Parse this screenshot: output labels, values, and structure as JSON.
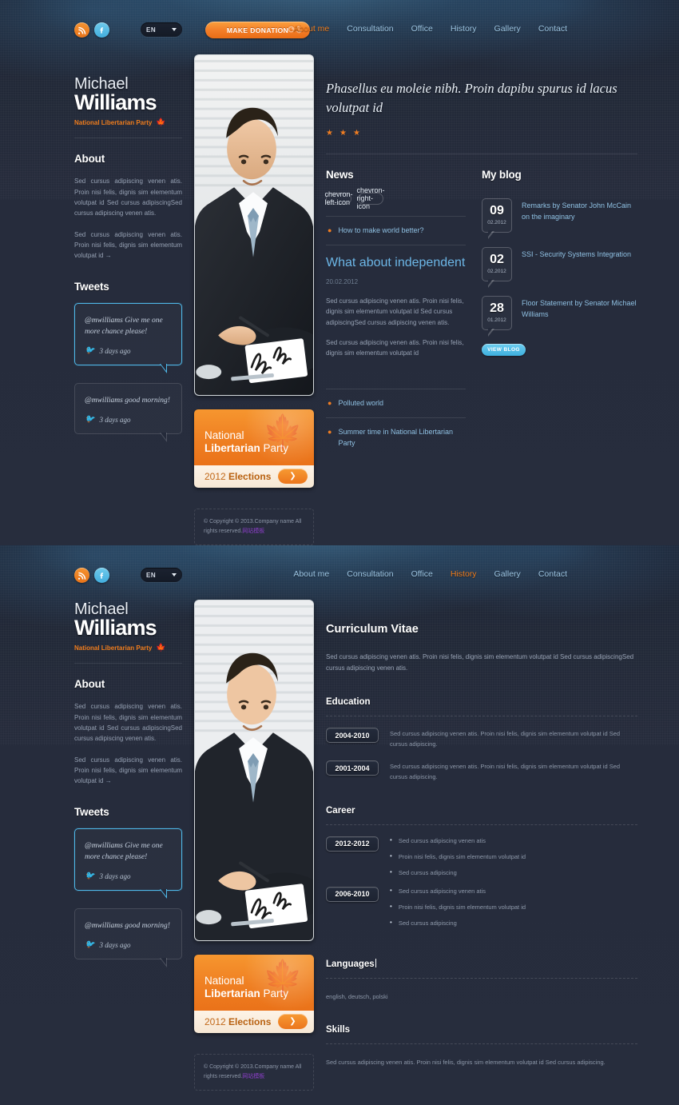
{
  "brand": {
    "first_name": "Michael",
    "last_name": "Williams",
    "party": "National Libertarian Party",
    "leaf_icon": "maple-leaf-icon"
  },
  "header": {
    "social": [
      {
        "name": "rss-icon",
        "label": "RSS"
      },
      {
        "name": "facebook-icon",
        "label": "f"
      }
    ],
    "language": {
      "value": "EN",
      "caret": "chevron-down-icon"
    },
    "donation_button": "MAKE DONATION",
    "nav": [
      {
        "label": "About me",
        "active": true
      },
      {
        "label": "Consultation",
        "active": false
      },
      {
        "label": "Office",
        "active": false
      },
      {
        "label": "History",
        "active": false
      },
      {
        "label": "Gallery",
        "active": false
      },
      {
        "label": "Contact",
        "active": false
      }
    ]
  },
  "header2": {
    "nav": [
      {
        "label": "About me",
        "active": false
      },
      {
        "label": "Consultation",
        "active": false
      },
      {
        "label": "Office",
        "active": false
      },
      {
        "label": "History",
        "active": true
      },
      {
        "label": "Gallery",
        "active": false
      },
      {
        "label": "Contact",
        "active": false
      }
    ]
  },
  "sidebar": {
    "about_title": "About",
    "about_p1": "Sed cursus adipiscing venen atis. Proin nisi felis, dignis sim elementum volutpat id Sed cursus adipiscingSed cursus adipiscing venen atis.",
    "about_p2": "Sed cursus adipiscing venen atis. Proin nisi felis, dignis sim elementum volutpat id",
    "about_arrow": "→",
    "tweets_title": "Tweets",
    "tweets": [
      {
        "handle": "@mwilliams",
        "text": "Give me one more chance please!",
        "time": "3 days ago",
        "active": true
      },
      {
        "handle": "@mwilliams",
        "text": "good morning!",
        "time": "3 days ago",
        "active": false
      }
    ]
  },
  "banner": {
    "line1": "National",
    "line2_bold": "Libertarian",
    "line2_rest": " Party",
    "bottom_year": "2012 ",
    "bottom_bold": "Elections",
    "go_icon": "chevron-right-icon"
  },
  "footer": {
    "text": "© Copyright © 2013.Company name All rights reserved.",
    "cn_text": "网站模板"
  },
  "main": {
    "quote": "Phasellus eu moleie nibh. Proin dapibu spurus id lacus volutpat id",
    "stars": [
      "★",
      "★",
      "★"
    ],
    "news": {
      "title": "News",
      "prev_icon": "chevron-left-icon",
      "next_icon": "chevron-right-icon",
      "top_item": "How to make world better?",
      "headline": "What about independent",
      "date": "20.02.2012",
      "body_p1": "Sed cursus adipiscing venen atis. Proin nisi felis, dignis sim elementum volutpat id Sed cursus adipiscingSed cursus adipiscing venen atis.",
      "body_p2": "Sed cursus adipiscing venen atis. Proin nisi felis, dignis sim elementum volutpat id",
      "more_items": [
        "Polluted world",
        "Summer time in National Libertarian Party"
      ]
    },
    "blog": {
      "title": "My blog",
      "entries": [
        {
          "day": "09",
          "monthyear": "02.2012",
          "title": "Remarks by Senator John McCain on the imaginary"
        },
        {
          "day": "02",
          "monthyear": "02.2012",
          "title": "SSI - Security Systems Integration"
        },
        {
          "day": "28",
          "monthyear": "01.2012",
          "title": "Floor Statement by Senator Michael Williams"
        }
      ],
      "view_button": "VIEW BLOG"
    }
  },
  "cv": {
    "title": "Curriculum Vitae",
    "intro": "Sed cursus adipiscing venen atis. Proin nisi felis, dignis sim elementum volutpat id Sed cursus adipiscingSed cursus adipiscing venen atis.",
    "education_title": "Education",
    "education": [
      {
        "years": "2004-2010",
        "text": "Sed cursus adipiscing venen atis. Proin nisi felis, dignis sim elementum volutpat id Sed cursus adipiscing."
      },
      {
        "years": "2001-2004",
        "text": "Sed cursus adipiscing venen atis. Proin nisi felis, dignis sim elementum volutpat id Sed cursus adipiscing."
      }
    ],
    "career_title": "Career",
    "career": [
      {
        "years": "2012-2012",
        "items": [
          "Sed cursus adipiscing venen atis",
          "Proin nisi felis, dignis sim elementum volutpat id",
          "Sed cursus adipiscing"
        ]
      },
      {
        "years": "2006-2010",
        "items": [
          "Sed cursus adipiscing venen atis",
          "Proin nisi felis, dignis sim elementum volutpat id",
          "Sed cursus adipiscing"
        ]
      }
    ],
    "languages_title": "Languages",
    "languages_value": "english, deutsch, polski",
    "skills_title": "Skills",
    "skills_value": "Sed cursus adipiscing venen atis. Proin nisi felis, dignis sim elementum volutpat id Sed cursus adipiscing."
  },
  "colors": {
    "accent_orange": "#f07d1d",
    "accent_cyan": "#4fb8e8",
    "bg_dark": "#242a3a",
    "link_blue": "#8fc0e2"
  }
}
